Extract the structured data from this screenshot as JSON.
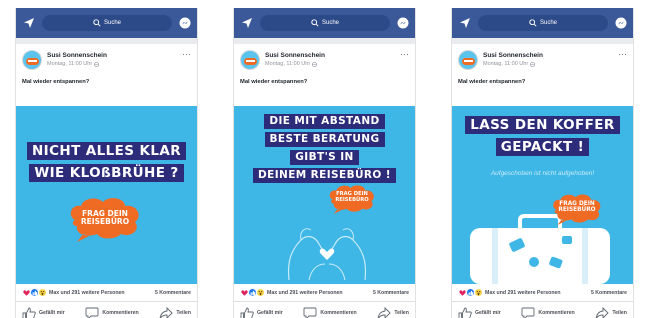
{
  "search_placeholder": "Suche",
  "post": {
    "author": "Susi Sonnenschein",
    "time": "Montag, 11:00 Uhr",
    "caption": "Mal wieder entspannen?",
    "reactions_text": "Max und 291 weitere Personen",
    "comments_text": "5 Kommentare",
    "actions": {
      "like": "Gefällt mir",
      "comment": "Kommentieren",
      "share": "Teilen"
    }
  },
  "phones": [
    {
      "headline": [
        "NICHT ALLES KLAR",
        "WIE KLOßBRÜHE ?"
      ],
      "cloud_lines": [
        "FRAG DEIN",
        "REISEBÜRO"
      ]
    },
    {
      "headline": [
        "DIE MIT ABSTAND",
        "BESTE BERATUNG",
        "GIBT'S IN",
        "DEINEM REISEBÜRO !"
      ],
      "cloud_lines": [
        "FRAG DEIN",
        "REISEBÜRO"
      ]
    },
    {
      "headline": [
        "LASS DEN KOFFER",
        "GEPACKT !"
      ],
      "subline": "Aufgeschoben ist nicht aufgehoben!",
      "cloud_lines": [
        "FRAG DEIN",
        "REISEBÜRO"
      ]
    }
  ],
  "colors": {
    "facebook_blue": "#3b5998",
    "ad_background": "#3fb7e6",
    "headline_box": "#2d2c7a",
    "cloud_orange": "#ef6b24"
  },
  "icons": [
    "send-icon",
    "search-icon",
    "messenger-icon",
    "globe-icon",
    "more-icon",
    "love-reaction-icon",
    "like-reaction-icon",
    "wow-reaction-icon",
    "like-icon",
    "comment-icon",
    "share-icon"
  ]
}
